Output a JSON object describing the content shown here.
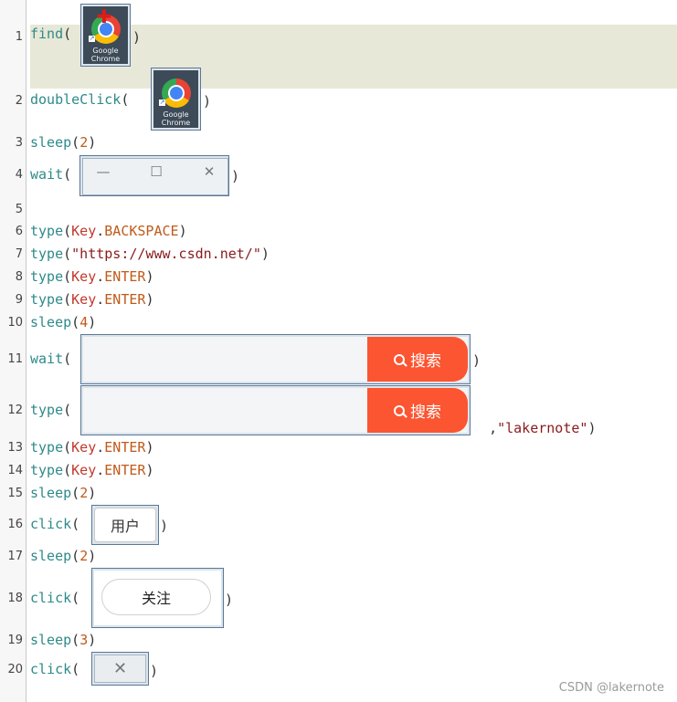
{
  "editor": {
    "lines": [
      {
        "num": "1",
        "fn": "find",
        "open": "(",
        "close": ")"
      },
      {
        "num": "2",
        "fn": "doubleClick",
        "open": "(",
        "close": ")"
      },
      {
        "num": "3",
        "fn": "sleep",
        "open": "(",
        "arg": "2",
        "close": ")"
      },
      {
        "num": "4",
        "fn": "wait",
        "open": "(",
        "close": ")"
      },
      {
        "num": "5"
      },
      {
        "num": "6",
        "fn": "type",
        "open": "(",
        "key": "Key",
        "dot": ".",
        "const": "BACKSPACE",
        "close": ")"
      },
      {
        "num": "7",
        "fn": "type",
        "open": "(",
        "str": "\"https://www.csdn.net/\"",
        "close": ")"
      },
      {
        "num": "8",
        "fn": "type",
        "open": "(",
        "key": "Key",
        "dot": ".",
        "const": "ENTER",
        "close": ")"
      },
      {
        "num": "9",
        "fn": "type",
        "open": "(",
        "key": "Key",
        "dot": ".",
        "const": "ENTER",
        "close": ")"
      },
      {
        "num": "10",
        "fn": "sleep",
        "open": "(",
        "arg": "4",
        "close": ")"
      },
      {
        "num": "11",
        "fn": "wait",
        "open": "(",
        "close": ")"
      },
      {
        "num": "12",
        "fn": "type",
        "open": "(",
        "sep": ",",
        "str": "\"lakernote\"",
        "close": ")"
      },
      {
        "num": "13",
        "fn": "type",
        "open": "(",
        "key": "Key",
        "dot": ".",
        "const": "ENTER",
        "close": ")"
      },
      {
        "num": "14",
        "fn": "type",
        "open": "(",
        "key": "Key",
        "dot": ".",
        "const": "ENTER",
        "close": ")"
      },
      {
        "num": "15",
        "fn": "sleep",
        "open": "(",
        "arg": "2",
        "close": ")"
      },
      {
        "num": "16",
        "fn": "click",
        "open": "(",
        "close": ")"
      },
      {
        "num": "17",
        "fn": "sleep",
        "open": "(",
        "arg": "2",
        "close": ")"
      },
      {
        "num": "18",
        "fn": "click",
        "open": "(",
        "close": ")"
      },
      {
        "num": "19",
        "fn": "sleep",
        "open": "(",
        "arg": "3",
        "close": ")"
      },
      {
        "num": "20",
        "fn": "click",
        "open": "(",
        "close": ")"
      }
    ]
  },
  "images": {
    "chrome_caption": "Google Chrome",
    "search_button_label": "搜索",
    "user_button_label": "用户",
    "follow_button_label": "关注",
    "win_min": "—",
    "win_max": "☐",
    "win_close": "✕",
    "close_glyph": "✕",
    "cross_glyph": "✚",
    "shortcut_glyph": "↗"
  },
  "colors": {
    "function": "#2e8a8a",
    "number": "#c05a1a",
    "key": "#c0392b",
    "string": "#8b1a1a",
    "search_button": "#fc5531",
    "line_highlight": "#e8e8d8"
  },
  "icons": {
    "chrome_app": "google-chrome-icon",
    "search": "magnifier-icon",
    "close": "close-icon"
  },
  "watermark": "CSDN @lakernote"
}
